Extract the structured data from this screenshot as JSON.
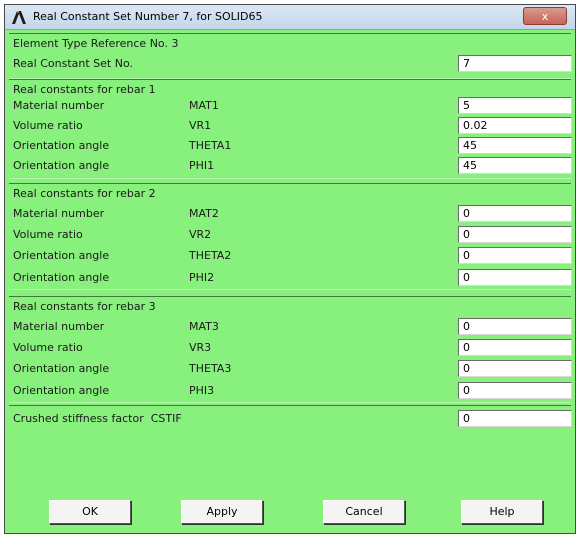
{
  "window": {
    "title": "Real Constant Set Number 7, for SOLID65",
    "close_label": "x"
  },
  "header": {
    "element_type_ref": "Element Type Reference No. 3",
    "set_label": "Real Constant Set No.",
    "set_value": "7"
  },
  "rebar1": {
    "heading": "Real constants for rebar 1",
    "rows": [
      {
        "label": "Material number",
        "symbol": "MAT1",
        "value": "5"
      },
      {
        "label": "Volume ratio",
        "symbol": "VR1",
        "value": "0.02"
      },
      {
        "label": "Orientation angle",
        "symbol": "THETA1",
        "value": "45"
      },
      {
        "label": "Orientation angle",
        "symbol": "PHI1",
        "value": "45"
      }
    ]
  },
  "rebar2": {
    "heading": "Real constants for rebar 2",
    "rows": [
      {
        "label": "Material number",
        "symbol": "MAT2",
        "value": "0"
      },
      {
        "label": "Volume ratio",
        "symbol": "VR2",
        "value": "0"
      },
      {
        "label": "Orientation angle",
        "symbol": "THETA2",
        "value": "0"
      },
      {
        "label": "Orientation angle",
        "symbol": "PHI2",
        "value": "0"
      }
    ]
  },
  "rebar3": {
    "heading": "Real constants for rebar 3",
    "rows": [
      {
        "label": "Material number",
        "symbol": "MAT3",
        "value": "0"
      },
      {
        "label": "Volume ratio",
        "symbol": "VR3",
        "value": "0"
      },
      {
        "label": "Orientation angle",
        "symbol": "THETA3",
        "value": "0"
      },
      {
        "label": "Orientation angle",
        "symbol": "PHI3",
        "value": "0"
      }
    ]
  },
  "crushed": {
    "label": "Crushed stiffness factor",
    "symbol": "CSTIF",
    "value": "0"
  },
  "buttons": {
    "ok": "OK",
    "apply": "Apply",
    "cancel": "Cancel",
    "help": "Help"
  },
  "colors": {
    "dialog_bg": "#88f07c",
    "title_bar": "#c3d6ea",
    "close_button": "#c7645a"
  },
  "icons": {
    "app": "ansys-logo-icon"
  }
}
